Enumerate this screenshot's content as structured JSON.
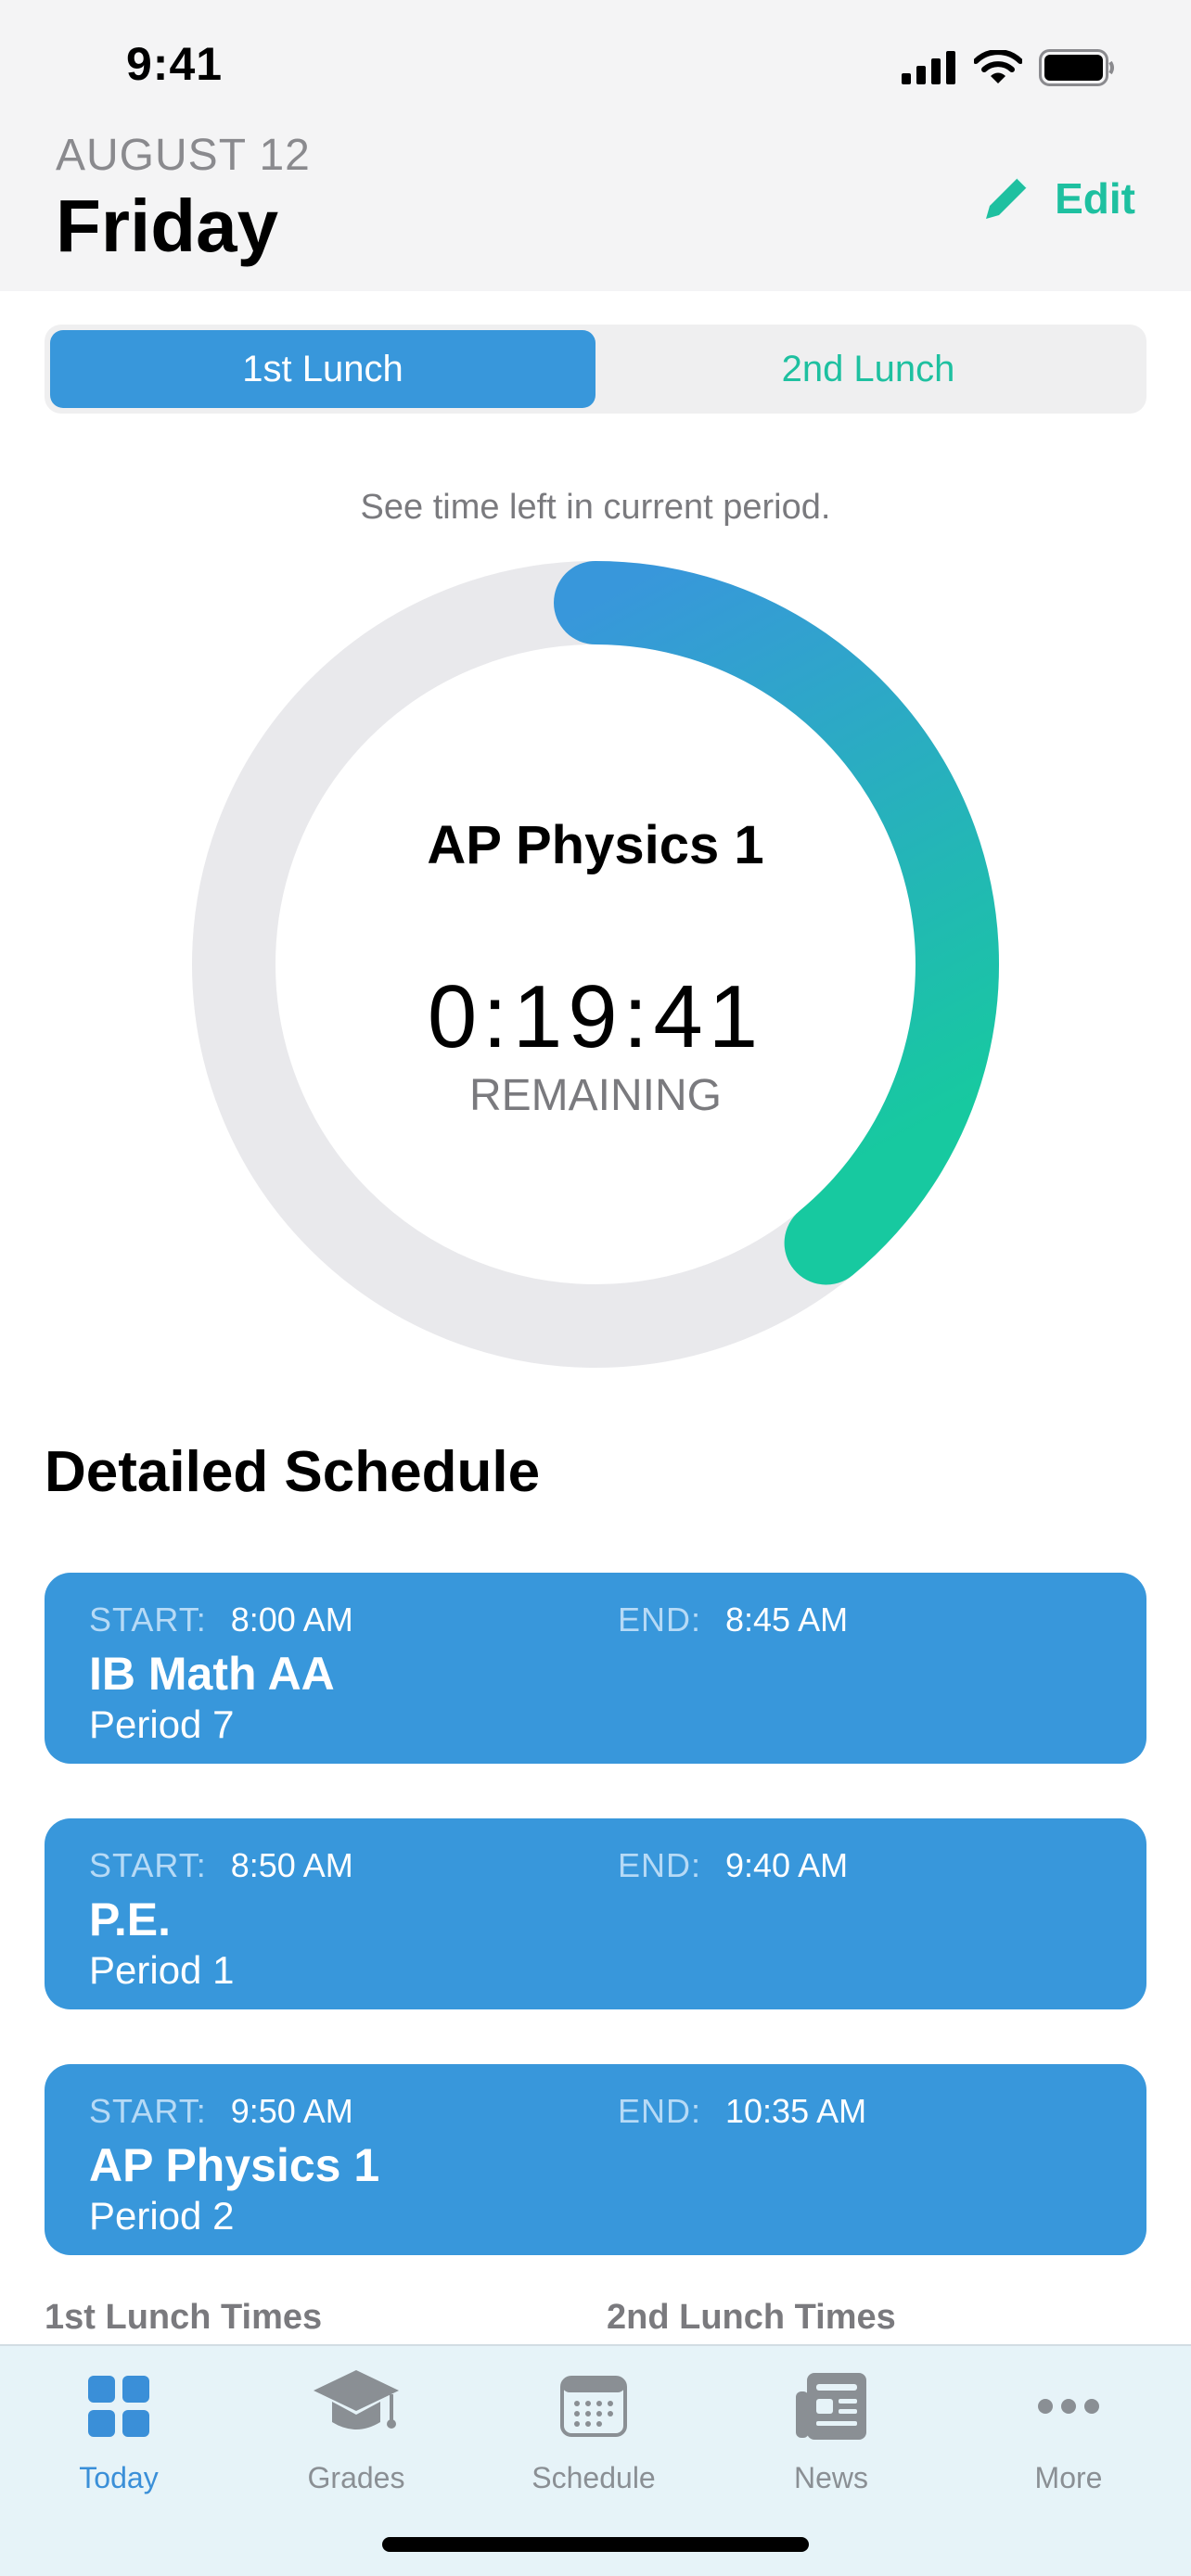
{
  "status_bar": {
    "time": "9:41"
  },
  "header": {
    "date": "AUGUST 12",
    "day": "Friday",
    "edit_label": "Edit"
  },
  "segmented": {
    "options": [
      "1st Lunch",
      "2nd Lunch"
    ],
    "selected": "1st Lunch"
  },
  "timer": {
    "hint": "See time left in current period.",
    "course": "AP Physics 1",
    "time_left": "0:19:41",
    "remaining_label": "REMAINING",
    "progress_fraction": 0.39
  },
  "schedule": {
    "title": "Detailed Schedule",
    "start_key": "START:",
    "end_key": "END:",
    "items": [
      {
        "start": "8:00 AM",
        "end": "8:45 AM",
        "course": "IB Math AA",
        "period": "Period 7"
      },
      {
        "start": "8:50 AM",
        "end": "9:40 AM",
        "course": "P.E.",
        "period": "Period 1"
      },
      {
        "start": "9:50 AM",
        "end": "10:35 AM",
        "course": "AP Physics 1",
        "period": "Period 2"
      }
    ],
    "lunch_labels": [
      "1st Lunch Times",
      "2nd Lunch Times"
    ]
  },
  "tabbar": {
    "tabs": [
      {
        "label": "Today",
        "icon": "grid-icon"
      },
      {
        "label": "Grades",
        "icon": "graduation-cap-icon"
      },
      {
        "label": "Schedule",
        "icon": "calendar-icon"
      },
      {
        "label": "News",
        "icon": "newspaper-icon"
      },
      {
        "label": "More",
        "icon": "ellipsis-icon"
      }
    ],
    "active": "Today"
  },
  "colors": {
    "accent_blue": "#3897db",
    "accent_teal": "#1ec0a0",
    "ring_track": "#e9e9ec"
  }
}
